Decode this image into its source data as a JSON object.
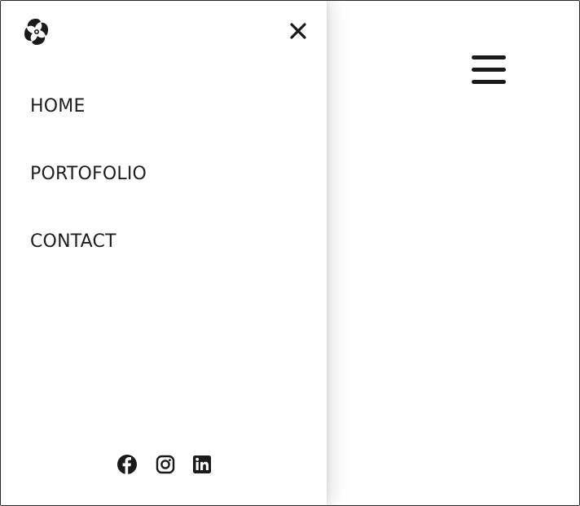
{
  "drawer": {
    "logo_icon": "pinwheel-logo-icon",
    "close_icon": "close-icon",
    "nav": [
      {
        "label": "HOME"
      },
      {
        "label": "PORTOFOLIO"
      },
      {
        "label": "CONTACT"
      }
    ],
    "socials": [
      {
        "icon": "facebook-icon"
      },
      {
        "icon": "instagram-icon"
      },
      {
        "icon": "linkedin-icon"
      }
    ]
  },
  "header": {
    "menu_icon": "hamburger-menu-icon"
  },
  "colors": {
    "text": "#1e1e1e",
    "background": "#ffffff",
    "icon": "#1a1a1a"
  }
}
